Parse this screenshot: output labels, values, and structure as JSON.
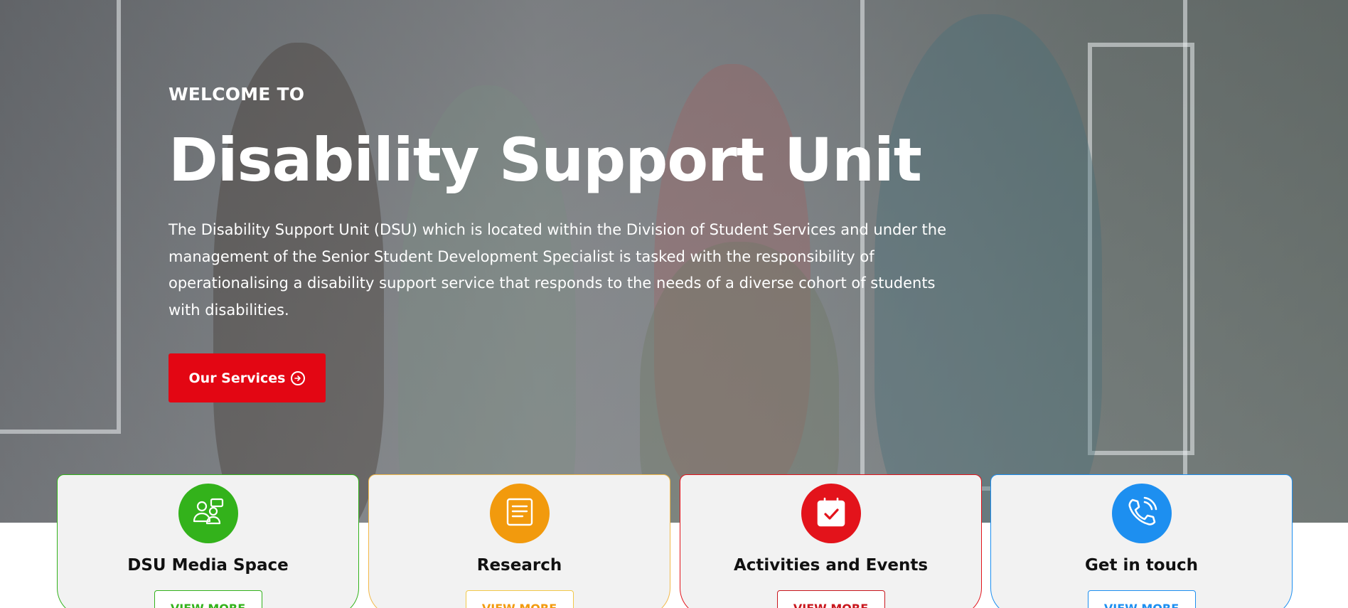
{
  "hero": {
    "welcome": "WELCOME TO",
    "title": "Disability Support Unit",
    "description": "The Disability Support Unit (DSU) which is located within the Division of Student Services and under the management of the Senior Student Development Specialist is tasked with the responsibility of operationalising a disability support service that responds to the needs of a diverse cohort of students with disabilities.",
    "cta_label": "Our Services",
    "cta_icon": "arrow-circle-right-icon"
  },
  "cards": [
    {
      "title": "DSU Media Space",
      "button": "VIEW MORE",
      "icon": "people-chat-icon",
      "accent": "#33b21b"
    },
    {
      "title": "Research",
      "button": "VIEW MORE",
      "icon": "document-list-icon",
      "accent": "#f29a0d"
    },
    {
      "title": "Activities and Events",
      "button": "VIEW MORE",
      "icon": "calendar-check-icon",
      "accent": "#e3131b"
    },
    {
      "title": "Get in touch",
      "button": "VIEW MORE",
      "icon": "phone-call-icon",
      "accent": "#1d8ff0"
    }
  ],
  "colors": {
    "primary_red": "#e30613",
    "green": "#33b21b",
    "orange": "#f29a0d",
    "red": "#e3131b",
    "blue": "#1d8ff0"
  }
}
